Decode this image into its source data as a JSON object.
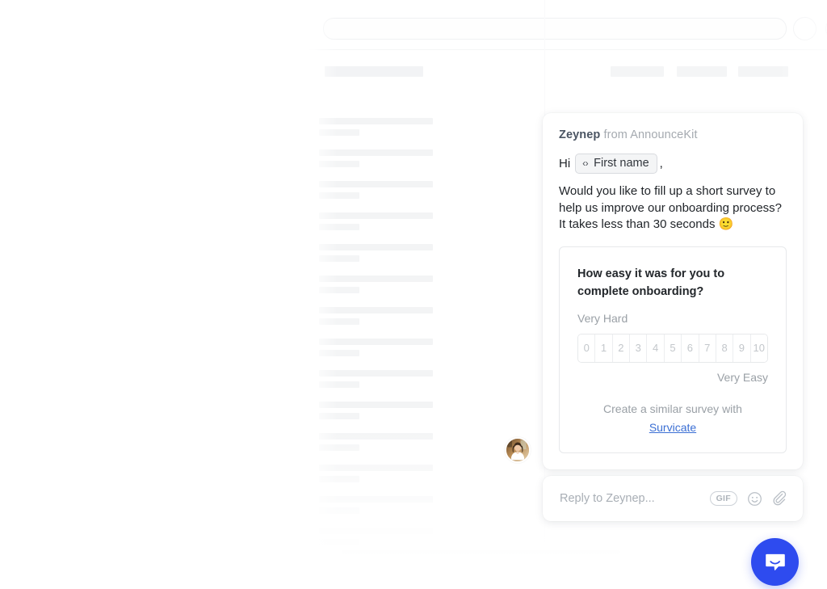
{
  "background": {
    "search_placeholder": "",
    "list_row_count": 14,
    "chips": [
      "",
      "",
      "",
      ""
    ]
  },
  "messenger": {
    "message": {
      "sender": "Zeynep",
      "from": "from AnnounceKit",
      "greeting_prefix": "Hi",
      "variable_pill": {
        "icon": "code-variable-icon",
        "label": "First name"
      },
      "greeting_suffix": ",",
      "body": "Would you like to fill up a short survey to help us improve our onboarding process? It takes less than 30 seconds 🙂"
    },
    "survey": {
      "question": "How easy it was for you to complete onboarding?",
      "anchor_low": "Very Hard",
      "anchor_high": "Very Easy",
      "scale": [
        "0",
        "1",
        "2",
        "3",
        "4",
        "5",
        "6",
        "7",
        "8",
        "9",
        "10"
      ],
      "footer_text": "Create a similar survey with",
      "footer_link": "Survicate",
      "link_color": "#3b6fd4"
    },
    "composer": {
      "placeholder": "Reply to Zeynep...",
      "gif_label": "GIF",
      "emoji_icon": "smiley-icon",
      "attach_icon": "paperclip-icon"
    },
    "launcher": {
      "icon": "intercom-chat-icon",
      "color": "#2e4bef"
    },
    "avatar_alt": "Zeynep avatar"
  }
}
